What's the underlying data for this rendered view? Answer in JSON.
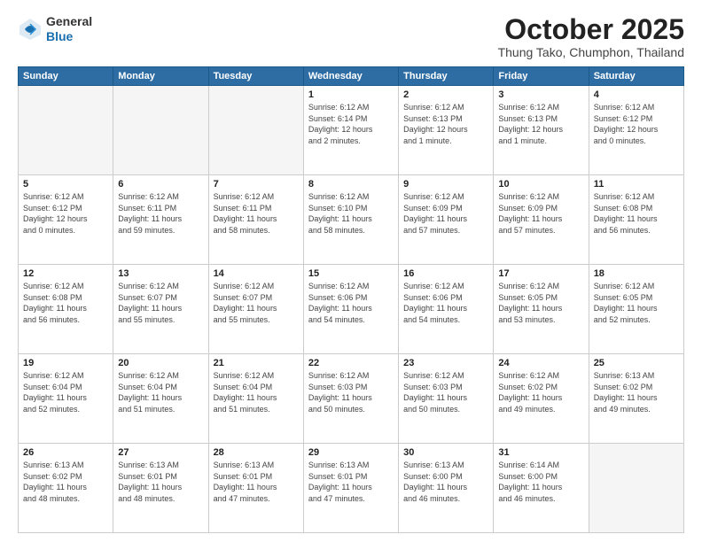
{
  "logo": {
    "general": "General",
    "blue": "Blue"
  },
  "header": {
    "month": "October 2025",
    "location": "Thung Tako, Chumphon, Thailand"
  },
  "weekdays": [
    "Sunday",
    "Monday",
    "Tuesday",
    "Wednesday",
    "Thursday",
    "Friday",
    "Saturday"
  ],
  "weeks": [
    [
      {
        "day": "",
        "info": ""
      },
      {
        "day": "",
        "info": ""
      },
      {
        "day": "",
        "info": ""
      },
      {
        "day": "1",
        "info": "Sunrise: 6:12 AM\nSunset: 6:14 PM\nDaylight: 12 hours\nand 2 minutes."
      },
      {
        "day": "2",
        "info": "Sunrise: 6:12 AM\nSunset: 6:13 PM\nDaylight: 12 hours\nand 1 minute."
      },
      {
        "day": "3",
        "info": "Sunrise: 6:12 AM\nSunset: 6:13 PM\nDaylight: 12 hours\nand 1 minute."
      },
      {
        "day": "4",
        "info": "Sunrise: 6:12 AM\nSunset: 6:12 PM\nDaylight: 12 hours\nand 0 minutes."
      }
    ],
    [
      {
        "day": "5",
        "info": "Sunrise: 6:12 AM\nSunset: 6:12 PM\nDaylight: 12 hours\nand 0 minutes."
      },
      {
        "day": "6",
        "info": "Sunrise: 6:12 AM\nSunset: 6:11 PM\nDaylight: 11 hours\nand 59 minutes."
      },
      {
        "day": "7",
        "info": "Sunrise: 6:12 AM\nSunset: 6:11 PM\nDaylight: 11 hours\nand 58 minutes."
      },
      {
        "day": "8",
        "info": "Sunrise: 6:12 AM\nSunset: 6:10 PM\nDaylight: 11 hours\nand 58 minutes."
      },
      {
        "day": "9",
        "info": "Sunrise: 6:12 AM\nSunset: 6:09 PM\nDaylight: 11 hours\nand 57 minutes."
      },
      {
        "day": "10",
        "info": "Sunrise: 6:12 AM\nSunset: 6:09 PM\nDaylight: 11 hours\nand 57 minutes."
      },
      {
        "day": "11",
        "info": "Sunrise: 6:12 AM\nSunset: 6:08 PM\nDaylight: 11 hours\nand 56 minutes."
      }
    ],
    [
      {
        "day": "12",
        "info": "Sunrise: 6:12 AM\nSunset: 6:08 PM\nDaylight: 11 hours\nand 56 minutes."
      },
      {
        "day": "13",
        "info": "Sunrise: 6:12 AM\nSunset: 6:07 PM\nDaylight: 11 hours\nand 55 minutes."
      },
      {
        "day": "14",
        "info": "Sunrise: 6:12 AM\nSunset: 6:07 PM\nDaylight: 11 hours\nand 55 minutes."
      },
      {
        "day": "15",
        "info": "Sunrise: 6:12 AM\nSunset: 6:06 PM\nDaylight: 11 hours\nand 54 minutes."
      },
      {
        "day": "16",
        "info": "Sunrise: 6:12 AM\nSunset: 6:06 PM\nDaylight: 11 hours\nand 54 minutes."
      },
      {
        "day": "17",
        "info": "Sunrise: 6:12 AM\nSunset: 6:05 PM\nDaylight: 11 hours\nand 53 minutes."
      },
      {
        "day": "18",
        "info": "Sunrise: 6:12 AM\nSunset: 6:05 PM\nDaylight: 11 hours\nand 52 minutes."
      }
    ],
    [
      {
        "day": "19",
        "info": "Sunrise: 6:12 AM\nSunset: 6:04 PM\nDaylight: 11 hours\nand 52 minutes."
      },
      {
        "day": "20",
        "info": "Sunrise: 6:12 AM\nSunset: 6:04 PM\nDaylight: 11 hours\nand 51 minutes."
      },
      {
        "day": "21",
        "info": "Sunrise: 6:12 AM\nSunset: 6:04 PM\nDaylight: 11 hours\nand 51 minutes."
      },
      {
        "day": "22",
        "info": "Sunrise: 6:12 AM\nSunset: 6:03 PM\nDaylight: 11 hours\nand 50 minutes."
      },
      {
        "day": "23",
        "info": "Sunrise: 6:12 AM\nSunset: 6:03 PM\nDaylight: 11 hours\nand 50 minutes."
      },
      {
        "day": "24",
        "info": "Sunrise: 6:12 AM\nSunset: 6:02 PM\nDaylight: 11 hours\nand 49 minutes."
      },
      {
        "day": "25",
        "info": "Sunrise: 6:13 AM\nSunset: 6:02 PM\nDaylight: 11 hours\nand 49 minutes."
      }
    ],
    [
      {
        "day": "26",
        "info": "Sunrise: 6:13 AM\nSunset: 6:02 PM\nDaylight: 11 hours\nand 48 minutes."
      },
      {
        "day": "27",
        "info": "Sunrise: 6:13 AM\nSunset: 6:01 PM\nDaylight: 11 hours\nand 48 minutes."
      },
      {
        "day": "28",
        "info": "Sunrise: 6:13 AM\nSunset: 6:01 PM\nDaylight: 11 hours\nand 47 minutes."
      },
      {
        "day": "29",
        "info": "Sunrise: 6:13 AM\nSunset: 6:01 PM\nDaylight: 11 hours\nand 47 minutes."
      },
      {
        "day": "30",
        "info": "Sunrise: 6:13 AM\nSunset: 6:00 PM\nDaylight: 11 hours\nand 46 minutes."
      },
      {
        "day": "31",
        "info": "Sunrise: 6:14 AM\nSunset: 6:00 PM\nDaylight: 11 hours\nand 46 minutes."
      },
      {
        "day": "",
        "info": ""
      }
    ]
  ]
}
